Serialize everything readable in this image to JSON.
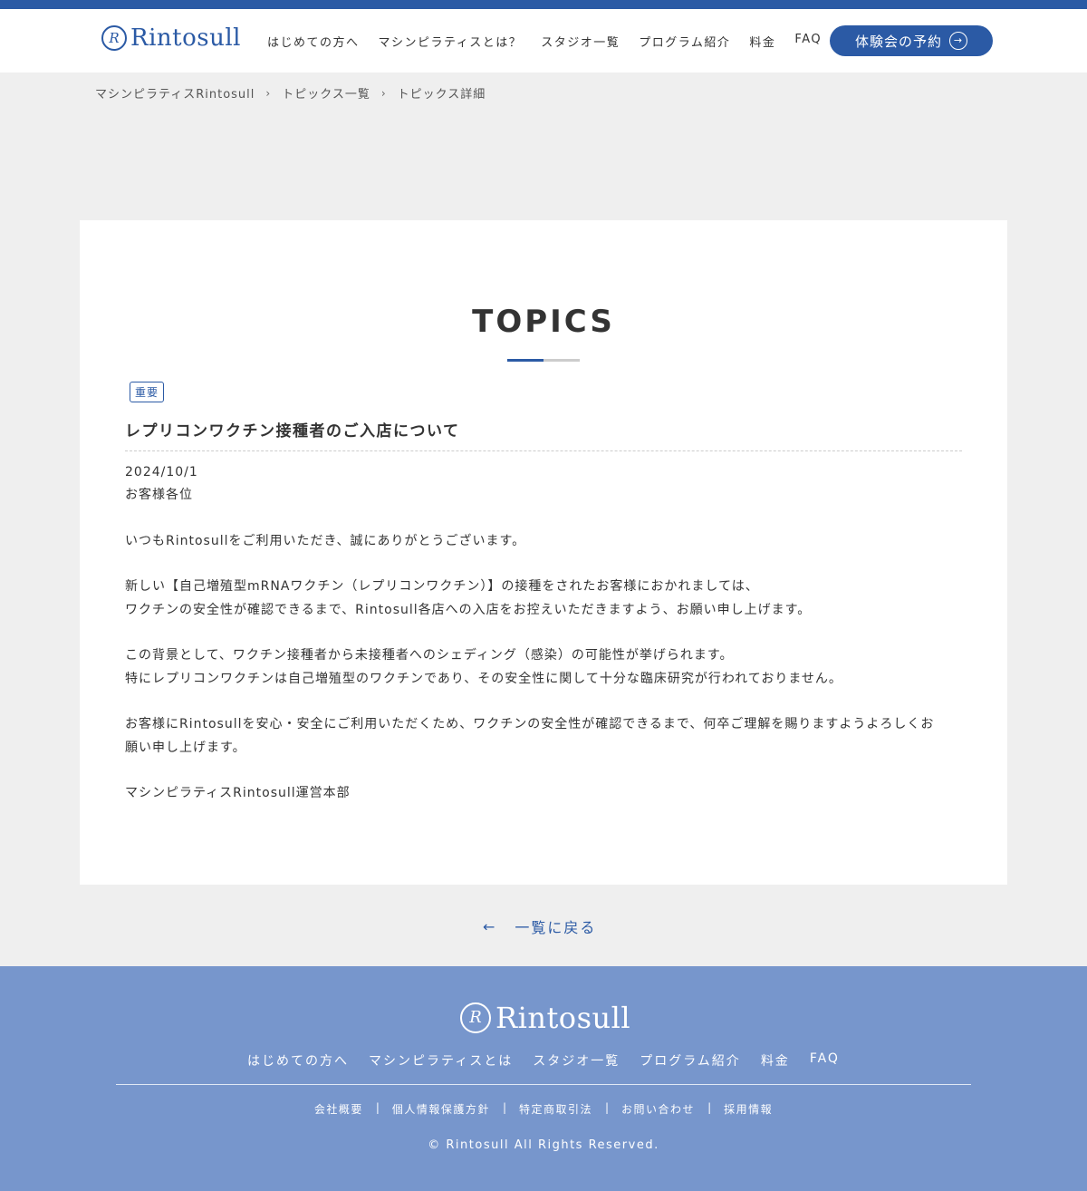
{
  "header": {
    "logo_mark": "R",
    "logo_text": "Rintosull",
    "nav": [
      "はじめての方へ",
      "マシンピラティスとは？",
      "スタジオ一覧",
      "プログラム紹介",
      "料金",
      "FAQ"
    ],
    "reserve_label": "体験会の予約",
    "reserve_icon": "→"
  },
  "breadcrumb": {
    "items": [
      "マシンピラティスRintosull",
      "トピックス一覧",
      "トピックス詳細"
    ],
    "separator": "›"
  },
  "article": {
    "section_title": "TOPICS",
    "badge": "重要",
    "title": "レプリコンワクチン接種者のご入店について",
    "date": "2024/10/1",
    "lines": [
      "お客様各位",
      "",
      "いつもRintosullをご利用いただき、誠にありがとうございます。",
      "",
      "新しい【自己増殖型mRNAワクチン（レプリコンワクチン）】の接種をされたお客様におかれましては、",
      "ワクチンの安全性が確認できるまで、Rintosull各店への入店をお控えいただきますよう、お願い申し上げます。",
      "",
      "この背景として、ワクチン接種者から未接種者へのシェディング（感染）の可能性が挙げられます。",
      "特にレプリコンワクチンは自己増殖型のワクチンであり、その安全性に関して十分な臨床研究が行われておりません。",
      "",
      "お客様にRintosullを安心・安全にご利用いただくため、ワクチンの安全性が確認できるまで、何卒ご理解を賜りますようよろしくお",
      "願い申し上げます。",
      "",
      "マシンピラティスRintosull運営本部"
    ]
  },
  "back_link": {
    "arrow": "←",
    "label": "一覧に戻る"
  },
  "footer": {
    "logo_mark": "R",
    "logo_text": "Rintosull",
    "nav": [
      "はじめての方へ",
      "マシンピラティスとは",
      "スタジオ一覧",
      "プログラム紹介",
      "料金",
      "FAQ"
    ],
    "sub_links": [
      "会社概要",
      "個人情報保護方針",
      "特定商取引法",
      "お問い合わせ",
      "採用情報"
    ],
    "copyright": "© Rintosull All Rights Reserved."
  },
  "colors": {
    "brand_blue": "#2b5aa5",
    "footer_bg": "#7796cc",
    "page_bg": "#efefef"
  }
}
